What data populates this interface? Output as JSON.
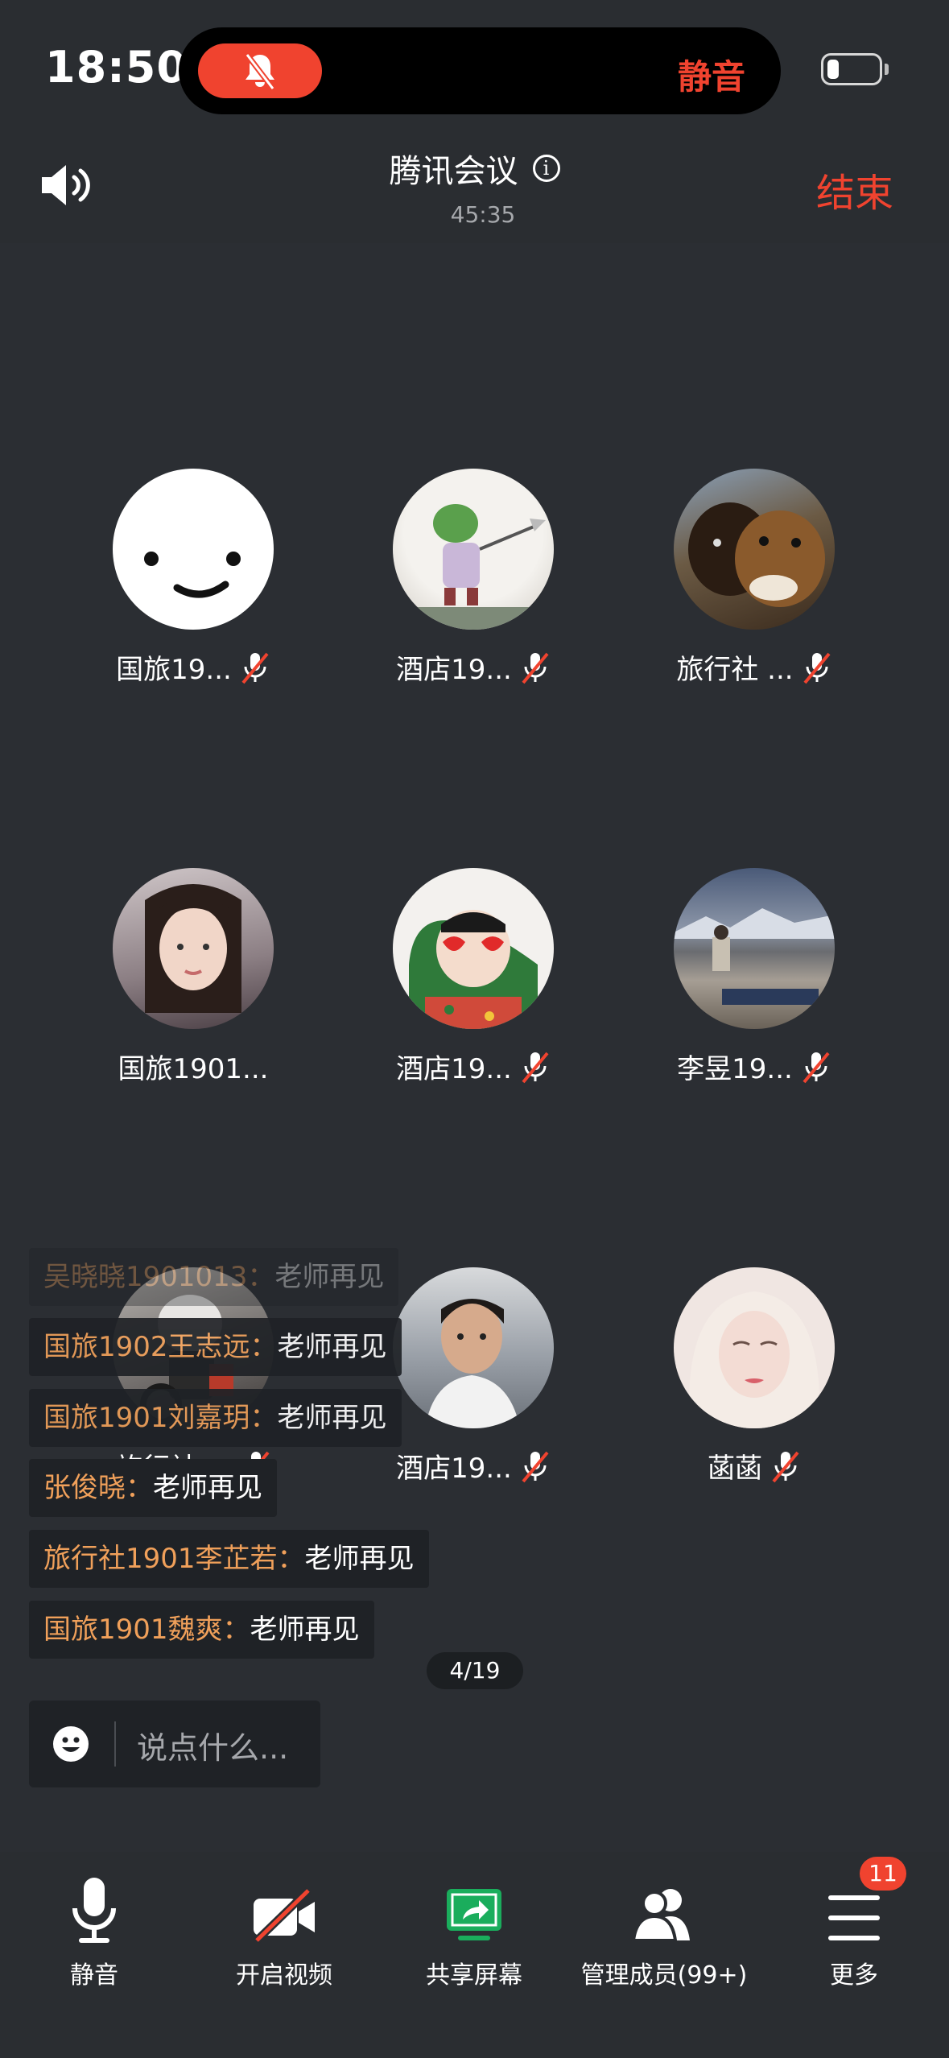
{
  "status_bar": {
    "time": "18:50",
    "mute_status": "静音"
  },
  "header": {
    "title": "腾讯会议",
    "duration": "45:35",
    "end_label": "结束"
  },
  "participants": [
    {
      "name": "国旅19...",
      "muted": true
    },
    {
      "name": "酒店19...",
      "muted": true
    },
    {
      "name": "旅行社 ...",
      "muted": true
    },
    {
      "name": "国旅1901...",
      "muted": false
    },
    {
      "name": "酒店19...",
      "muted": true
    },
    {
      "name": "李昱19...",
      "muted": true
    },
    {
      "name": "旅行社 ...",
      "muted": true
    },
    {
      "name": "酒店19...",
      "muted": true
    },
    {
      "name": "菡菡",
      "muted": true
    }
  ],
  "chat": {
    "messages": [
      {
        "sender": "吴晓晓1901013：",
        "text": "老师再见"
      },
      {
        "sender": "国旅1902王志远：",
        "text": "老师再见"
      },
      {
        "sender": "国旅1901刘嘉玥：",
        "text": "老师再见"
      },
      {
        "sender": "张俊晓：",
        "text": "老师再见"
      },
      {
        "sender": "旅行社1901李芷若：",
        "text": "老师再见"
      },
      {
        "sender": "国旅1901魏爽：",
        "text": "老师再见"
      }
    ],
    "placeholder": "说点什么..."
  },
  "page_indicator": "4/19",
  "toolbar": {
    "mute": "静音",
    "video": "开启视频",
    "share": "共享屏幕",
    "members": "管理成员(99+)",
    "more": "更多",
    "more_badge": "11"
  },
  "colors": {
    "accent_red": "#f0432f",
    "chat_sender": "#f0a05a",
    "share_green": "#1aad5c",
    "background": "#2b2e33"
  }
}
